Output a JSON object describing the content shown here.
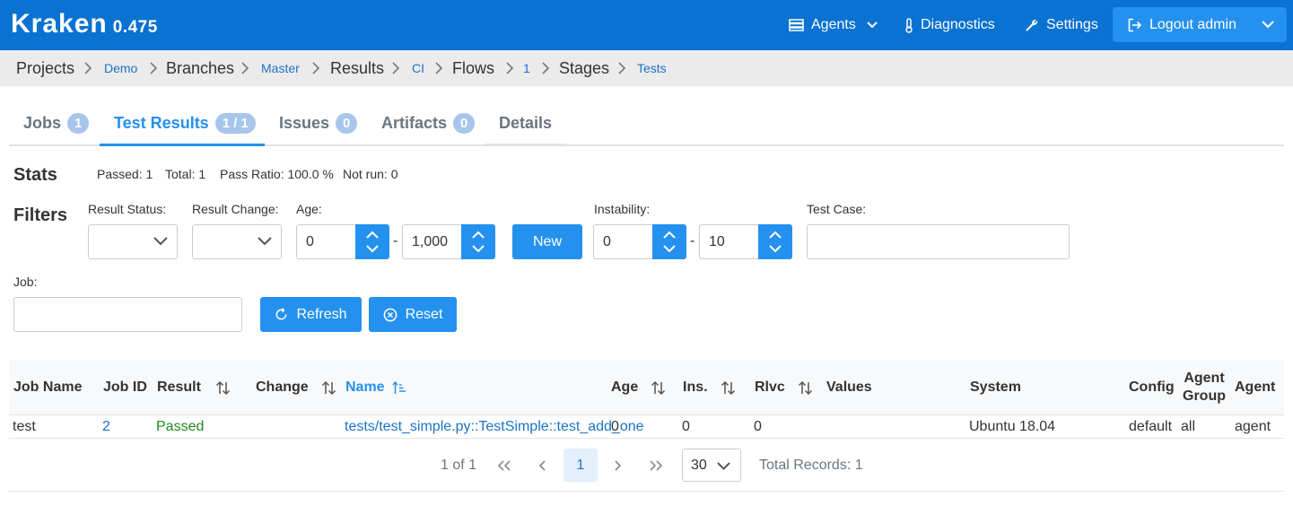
{
  "app": {
    "name": "Kraken",
    "version": "0.475"
  },
  "nav": {
    "agents": "Agents",
    "diagnostics": "Diagnostics",
    "settings": "Settings",
    "logout": "Logout admin"
  },
  "breadcrumb": [
    {
      "label": "Projects"
    },
    {
      "label": "Demo"
    },
    {
      "label": "Branches"
    },
    {
      "label": "Master"
    },
    {
      "label": "Results"
    },
    {
      "label": "CI"
    },
    {
      "label": "Flows"
    },
    {
      "label": "1"
    },
    {
      "label": "Stages"
    },
    {
      "label": "Tests"
    }
  ],
  "tabs": [
    {
      "label": "Jobs",
      "badge": "1"
    },
    {
      "label": "Test Results",
      "badge": "1 / 1"
    },
    {
      "label": "Issues",
      "badge": "0"
    },
    {
      "label": "Artifacts",
      "badge": "0"
    },
    {
      "label": "Details"
    }
  ],
  "stats": {
    "title": "Stats",
    "passed": "Passed: 1",
    "total": "Total: 1",
    "pass_ratio": "Pass Ratio: 100.0 %",
    "not_run": "Not run: 0"
  },
  "filters": {
    "title": "Filters",
    "result_status_label": "Result Status:",
    "result_change_label": "Result Change:",
    "age_label": "Age:",
    "age_from": "0",
    "age_to": "1,000",
    "new_button": "New",
    "instability_label": "Instability:",
    "instability_from": "0",
    "instability_to": "10",
    "test_case_label": "Test Case:",
    "job_label": "Job:",
    "dash": "-",
    "refresh": "Refresh",
    "reset": "Reset"
  },
  "table": {
    "columns": [
      "Job Name",
      "Job ID",
      "Result",
      "Change",
      "Name",
      "Age",
      "Ins.",
      "Rlvc",
      "Values",
      "System",
      "Config",
      "Agent Group",
      "Agent"
    ],
    "rows": [
      {
        "job_name": "test",
        "job_id": "2",
        "result": "Passed",
        "change": "",
        "name": "tests/test_simple.py::TestSimple::test_add_one",
        "age": "0",
        "ins": "0",
        "rlvc": "0",
        "values": "",
        "system": "Ubuntu 18.04",
        "config": "default",
        "agent_group": "all",
        "agent": "agent"
      }
    ]
  },
  "pagination": {
    "page_info": "1 of 1",
    "current_page": "1",
    "rows_per_page": "30",
    "total_records": "Total Records: 1"
  },
  "colors": {
    "primary": "#2591ee",
    "topbar": "#0a72d1",
    "link": "#1a73c7",
    "passed": "#1e8a1e"
  }
}
